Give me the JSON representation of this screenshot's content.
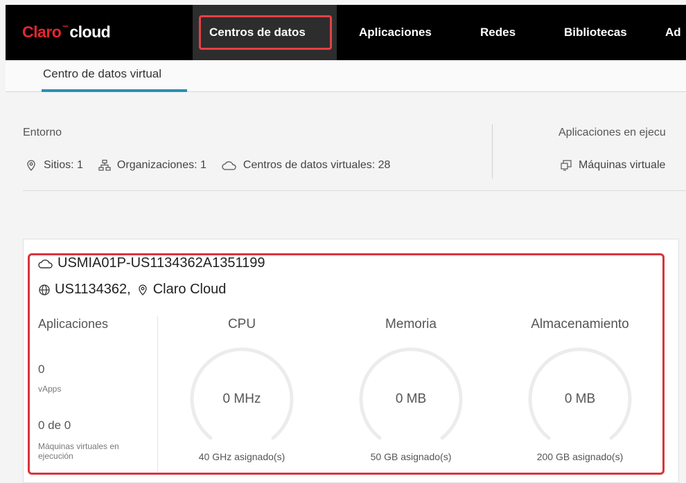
{
  "logo": {
    "brand": "Claro",
    "product": "cloud"
  },
  "nav": {
    "items": [
      "Centros de datos",
      "Aplicaciones",
      "Redes",
      "Bibliotecas",
      "Ad"
    ],
    "active_index": 0
  },
  "subnav": {
    "tab": "Centro de datos virtual"
  },
  "environment": {
    "title": "Entorno",
    "sites": "Sitios: 1",
    "organizations": "Organizaciones: 1",
    "vdcs": "Centros de datos virtuales: 28"
  },
  "running_apps": {
    "title": "Aplicaciones en ejecu",
    "vms": "Máquinas virtuale"
  },
  "vdc_card": {
    "name": "USMIA01P-US1134362A1351199",
    "org": "US1134362,",
    "site": "Claro Cloud",
    "apps": {
      "title": "Aplicaciones",
      "vapps_value": "0",
      "vapps_label": "vApps",
      "vms_value": "0 de 0",
      "vms_label": "Máquinas virtuales en ejecución"
    },
    "cpu": {
      "title": "CPU",
      "value": "0 MHz",
      "allocated": "40 GHz asignado(s)",
      "used_fraction": 0
    },
    "memory": {
      "title": "Memoria",
      "value": "0 MB",
      "allocated": "50 GB asignado(s)",
      "used_fraction": 0
    },
    "storage": {
      "title": "Almacenamiento",
      "value": "0 MB",
      "allocated": "200 GB asignado(s)",
      "used_fraction": 0
    }
  },
  "colors": {
    "highlight": "#e64046",
    "accent": "#2a8fb2",
    "nav_bg": "#000000",
    "brand_red": "#e3262e"
  }
}
